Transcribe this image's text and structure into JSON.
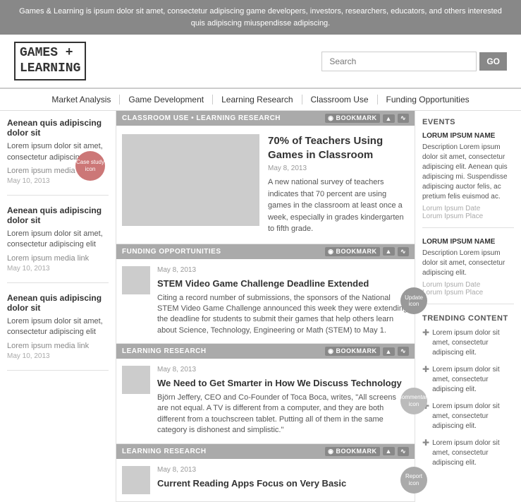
{
  "banner": {
    "text": "Games & Learning is ipsum dolor sit amet, consectetur adipiscing game developers, investors, researchers, educators, and others interested quis adipiscing miuspendisse adipiscing."
  },
  "header": {
    "logo_line1": "GAMES +",
    "logo_line2": "LEARNING",
    "search_placeholder": "Search",
    "go_label": "GO"
  },
  "nav": {
    "items": [
      {
        "label": "Market Analysis"
      },
      {
        "label": "Game Development"
      },
      {
        "label": "Learning Research"
      },
      {
        "label": "Classroom Use"
      },
      {
        "label": "Funding Opportunities"
      }
    ]
  },
  "left_sidebar": {
    "cards": [
      {
        "title": "Aenean quis adipiscing dolor sit",
        "body": "Lorem ipsum dolor sit amet, consectetur adipiscing elit",
        "link": "Lorem ipsum media link",
        "date": "May 10, 2013",
        "icon": ""
      },
      {
        "title": "Aenean quis adipiscing dolor sit",
        "body": "Lorem ipsum dolor sit amet, consectetur adipiscing elit",
        "link": "Lorem ipsum media link",
        "date": "May 10, 2013",
        "icon": ""
      },
      {
        "title": "Aenean quis adipiscing dolor sit",
        "body": "Lorem ipsum dolor sit amet, consectetur adipiscing elit",
        "link": "Lorem ipsum media link",
        "date": "May 10, 2013",
        "icon": ""
      }
    ],
    "case_study_label": "Case study icon"
  },
  "sections": [
    {
      "id": "classroom-learning",
      "header": "CLASSROOM USE • LEARNING RESEARCH",
      "bookmark": "BOOKMARK",
      "articles": [
        {
          "type": "featured",
          "title": "70% of Teachers Using Games in Classroom",
          "date": "May 8, 2013",
          "body": "A new national survey of teachers indicates that 70 percent are using games in the classroom at least once a week, especially in grades kindergarten to fifth grade."
        }
      ]
    },
    {
      "id": "funding",
      "header": "FUNDING OPPORTUNITIES",
      "bookmark": "BOOKMARK",
      "articles": [
        {
          "type": "small",
          "title": "STEM Video Game Challenge Deadline Extended",
          "date": "May 8, 2013",
          "body": "Citing a record number of submissions, the sponsors of the National STEM Video Game Challenge announced this week they were extending the deadline for students to submit their games that help others learn about Science, Technology, Engineering or Math (STEM) to May 1.",
          "icon": "Update icon"
        }
      ]
    },
    {
      "id": "learning-research1",
      "header": "LEARNING RESEARCH",
      "bookmark": "BOOKMARK",
      "articles": [
        {
          "type": "small",
          "title": "We Need to Get Smarter in How We Discuss Technology",
          "date": "May 8, 2013",
          "body": "Björn Jeffery, CEO and Co-Founder of Toca Boca, writes, \"All screens are not equal. A TV is different from a computer, and they are both different from a touchscreen tablet. Putting all of them in the same category is dishonest and simplistic.\"",
          "icon": "Commentary icon"
        }
      ]
    },
    {
      "id": "learning-research2",
      "header": "LEARNING RESEARCH",
      "bookmark": "BOOKMARK",
      "articles": [
        {
          "type": "small",
          "title": "Current Reading Apps Focus on Very Basic",
          "date": "May 8, 2013",
          "body": "",
          "icon": "Report icon"
        }
      ]
    }
  ],
  "right_sidebar": {
    "events_title": "EVENTS",
    "events": [
      {
        "name": "LORUM IPSUM NAME",
        "desc": "Description Lorem ipsum dolor sit amet, consectetur adipiscing elit. Aenean quis adipiscing mi. Suspendisse adipiscing auctor felis, ac pretium felis euismod ac.",
        "date": "Lorum Ipsum Date",
        "place": "Lorum Ipsum Place"
      },
      {
        "name": "LORUM IPSUM NAME",
        "desc": "Description Lorem ipsum dolor sit amet, consectetur adipiscing elit.",
        "date": "Lorum Ipsum Date",
        "place": "Lorum Ipsum Place"
      }
    ],
    "trending_title": "TRENDING CONTENT",
    "trending_items": [
      "Lorem ipsum dolor sit amet, consectetur adipiscing elit.",
      "Lorem ipsum dolor sit amet, consectetur adipiscing elit.",
      "Lorem ipsum dolor sit amet, consectetur adipiscing elit.",
      "Lorem ipsum dolor sit amet, consectetur adipiscing elit."
    ]
  }
}
